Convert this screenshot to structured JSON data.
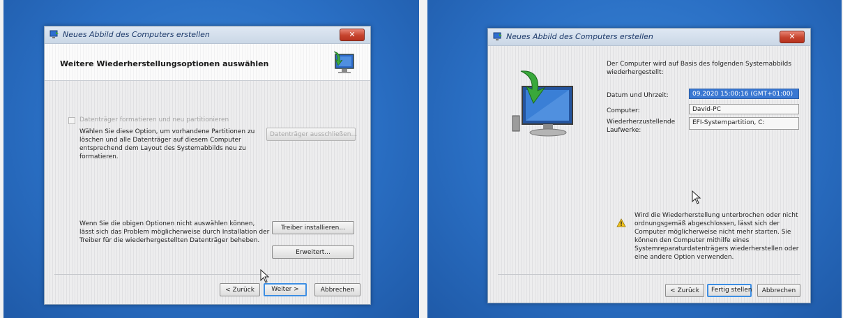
{
  "left_dialog": {
    "window_title": "Neues Abbild des Computers erstellen",
    "close_label": "✕",
    "heading": "Weitere Wiederherstellungsoptionen auswählen",
    "format_checkbox_label": "Datenträger formatieren und neu partitionieren",
    "format_description": [
      "Wählen Sie diese Option, um vorhandene Partitionen zu",
      "löschen und alle Datenträger auf diesem Computer",
      "entsprechend dem Layout des Systemabbilds neu zu",
      "formatieren."
    ],
    "exclude_disks_button": "Datenträger ausschließen...",
    "driver_description": [
      "Wenn Sie die obigen Optionen nicht auswählen können,",
      "lässt sich das Problem möglicherweise durch Installation der",
      "Treiber für die wiederhergestellten Datenträger beheben."
    ],
    "install_drivers_button": "Treiber installieren...",
    "advanced_button": "Erweitert...",
    "back_button": "< Zurück",
    "next_button": "Weiter >",
    "cancel_button": "Abbrechen"
  },
  "right_dialog": {
    "window_title": "Neues Abbild des Computers erstellen",
    "close_label": "✕",
    "intro": [
      "Der Computer wird auf Basis des folgenden Systemabbilds",
      "wiederhergestellt:"
    ],
    "details": [
      {
        "label": [
          "Datum und Uhrzeit:"
        ],
        "value": "09.2020 15:00:16 (GMT+01:00)",
        "selected": true
      },
      {
        "label": [
          "Computer:"
        ],
        "value": "David-PC",
        "selected": false
      },
      {
        "label": [
          "Wiederherzustellende",
          "Laufwerke:"
        ],
        "value": "EFI-Systempartition, C:",
        "selected": false
      }
    ],
    "warning": [
      "Wird die Wiederherstellung unterbrochen oder nicht",
      "ordnungsgemäß abgeschlossen, lässt sich der",
      "Computer möglicherweise nicht mehr starten. Sie",
      "können den Computer mithilfe eines",
      "Systemreparaturdatenträgers wiederherstellen oder",
      "eine andere Option verwenden."
    ],
    "back_button": "< Zurück",
    "finish_button": "Fertig stellen",
    "cancel_button": "Abbrechen"
  },
  "colors": {
    "desktop_blue": "#2a6fc4",
    "close_red": "#c6432d",
    "selection_blue": "#3a78d2",
    "focus_border": "#3d8ee3"
  }
}
